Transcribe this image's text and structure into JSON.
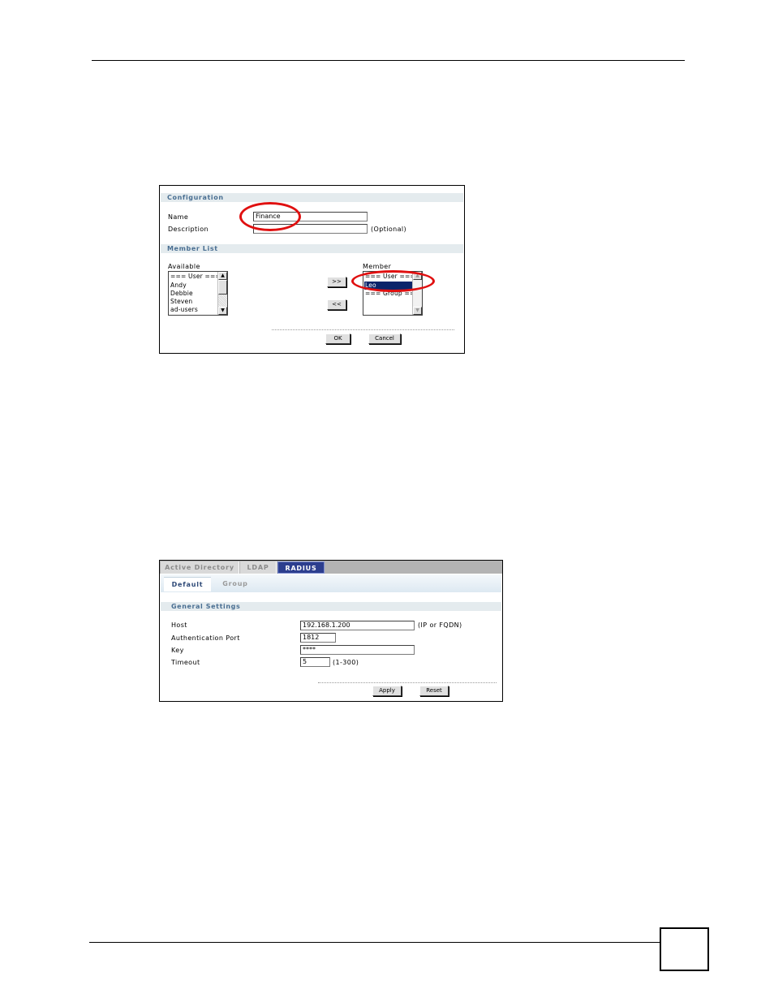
{
  "figure1": {
    "configuration_header": "Configuration",
    "name_label": "Name",
    "name_value": "Finance",
    "description_label": "Description",
    "description_value": "",
    "optional_hint": "(Optional)",
    "member_list_header": "Member List",
    "available_label": "Available",
    "available_items": [
      "=== User ===",
      "Andy",
      "Debbie",
      "Steven",
      "ad-users"
    ],
    "member_label": "Member",
    "member_items": [
      "=== User ===",
      "Leo",
      "=== Group ==="
    ],
    "member_selected_index": 1,
    "add_button": ">>",
    "remove_button": "<<",
    "ok_button": "OK",
    "cancel_button": "Cancel"
  },
  "figure2": {
    "tabs": [
      "Active Directory",
      "LDAP",
      "RADIUS"
    ],
    "active_tab": "RADIUS",
    "subtabs": [
      "Default",
      "Group"
    ],
    "active_subtab": "Default",
    "general_settings_header": "General Settings",
    "host_label": "Host",
    "host_value": "192.168.1.200",
    "host_hint": "(IP or FQDN)",
    "auth_port_label": "Authentication Port",
    "auth_port_value": "1812",
    "key_label": "Key",
    "key_value": "****",
    "timeout_label": "Timeout",
    "timeout_value": "5",
    "timeout_hint": "(1-300)",
    "apply_button": "Apply",
    "reset_button": "Reset"
  },
  "colors": {
    "section_bar": "#e4ebee",
    "section_text": "#4a6f92",
    "active_tab": "#2c3e8e",
    "selection": "#0a246a",
    "highlight": "#e01010"
  }
}
